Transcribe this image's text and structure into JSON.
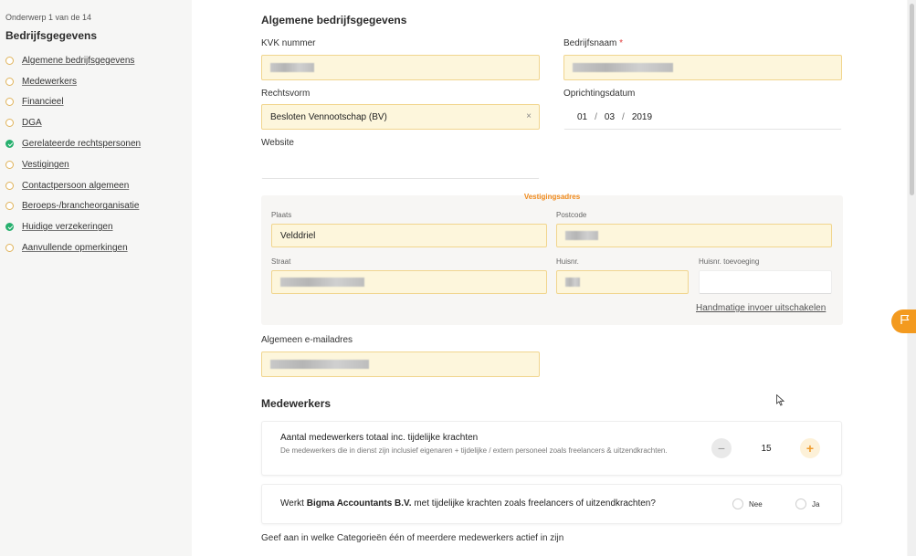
{
  "sidebar": {
    "counter": "Onderwerp 1 van de 14",
    "title": "Bedrijfsgegevens",
    "items": [
      {
        "label": "Algemene bedrijfsgegevens",
        "status": "open"
      },
      {
        "label": "Medewerkers",
        "status": "open"
      },
      {
        "label": "Financieel",
        "status": "open"
      },
      {
        "label": "DGA",
        "status": "open"
      },
      {
        "label": "Gerelateerde rechtspersonen",
        "status": "done"
      },
      {
        "label": "Vestigingen",
        "status": "open"
      },
      {
        "label": "Contactpersoon algemeen",
        "status": "open"
      },
      {
        "label": "Beroeps-/brancheorganisatie",
        "status": "open"
      },
      {
        "label": "Huidige verzekeringen",
        "status": "done"
      },
      {
        "label": "Aanvullende opmerkingen",
        "status": "open"
      }
    ]
  },
  "general": {
    "title": "Algemene bedrijfsgegevens",
    "kvk_label": "KVK nummer",
    "company_name_label": "Bedrijfsnaam",
    "required_mark": "*",
    "legal_form_label": "Rechtsvorm",
    "legal_form_value": "Besloten Vennootschap (BV)",
    "clear_symbol": "×",
    "founding_date_label": "Oprichtingsdatum",
    "date_day": "01",
    "date_month": "03",
    "date_year": "2019",
    "date_sep": "/",
    "website_label": "Website"
  },
  "address": {
    "heading": "Vestigingsadres",
    "city_label": "Plaats",
    "city_value": "Velddriel",
    "postcode_label": "Postcode",
    "street_label": "Straat",
    "house_number_label": "Huisnr.",
    "addition_label": "Huisnr. toevoeging",
    "manual_link": "Handmatige invoer uitschakelen"
  },
  "email": {
    "label": "Algemeen e-mailadres"
  },
  "employees": {
    "title": "Medewerkers",
    "total_question": "Aantal medewerkers totaal inc. tijdelijke krachten",
    "total_help": "De medewerkers die in dienst zijn inclusief eigenaren + tijdelijke / extern personeel zoals freelancers & uitzendkrachten.",
    "total_value": "15",
    "minus_symbol": "−",
    "plus_symbol": "+",
    "temp_question_prefix": "Werkt ",
    "temp_question_company": "Bigma Accountants B.V.",
    "temp_question_suffix": " met tijdelijke krachten zoals freelancers of uitzendkrachten?",
    "option_no": "Nee",
    "option_yes": "Ja",
    "categories_prompt": "Geef aan in welke Categorieën één of meerdere medewerkers actief in zijn"
  },
  "colors": {
    "accent": "#f39a1f",
    "field_bg": "#fdf6dc",
    "field_border": "#f1d58e",
    "done": "#27b06e"
  },
  "icons": {
    "flag": "flag-icon",
    "cursor": "mouse-cursor-icon"
  }
}
